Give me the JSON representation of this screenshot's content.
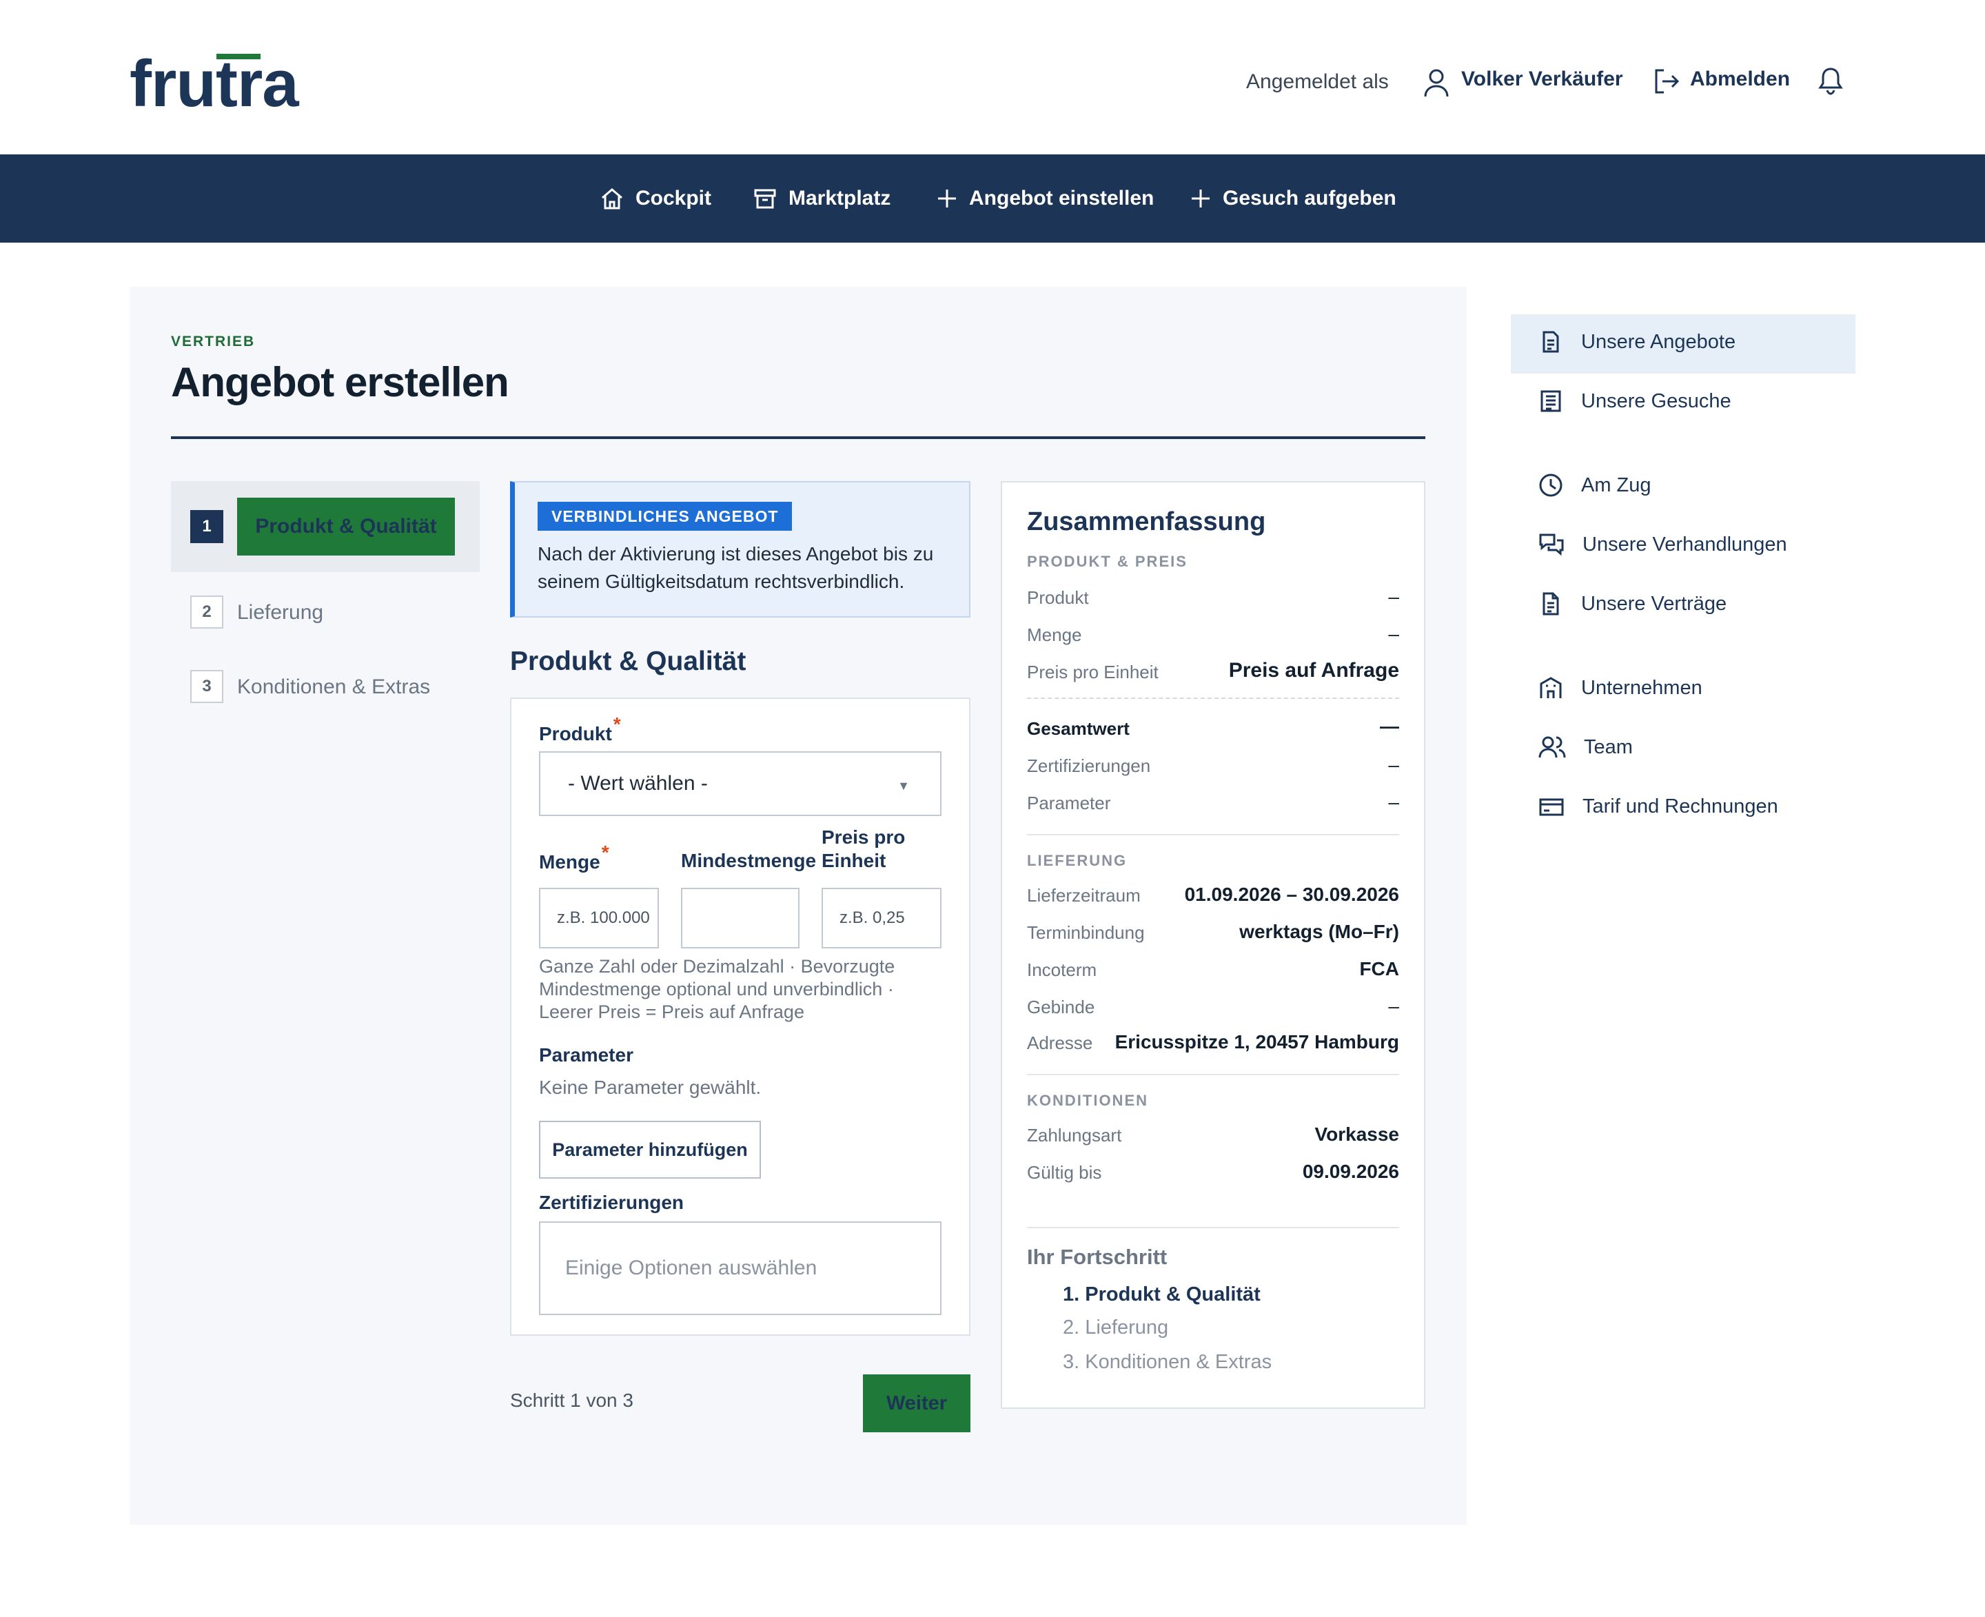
{
  "brand": {
    "logo": "frutra"
  },
  "header": {
    "logged_in_as": "Angemeldet als",
    "user_name": "Volker Verkäufer",
    "logout": "Abmelden"
  },
  "nav": [
    {
      "label": "Cockpit",
      "icon": "home-icon"
    },
    {
      "label": "Marktplatz",
      "icon": "archive-box-icon"
    },
    {
      "label": "Angebot einstellen",
      "icon": "plus-icon"
    },
    {
      "label": "Gesuch aufgeben",
      "icon": "plus-icon"
    }
  ],
  "page": {
    "kicker": "VERTRIEB",
    "title": "Angebot erstellen"
  },
  "stepper": [
    {
      "num": "1",
      "label": "Produkt & Qualität",
      "active": true
    },
    {
      "num": "2",
      "label": "Lieferung",
      "active": false
    },
    {
      "num": "3",
      "label": "Konditionen & Extras",
      "active": false
    }
  ],
  "notice": {
    "badge": "VERBINDLICHES ANGEBOT",
    "text": "Nach der Aktivierung ist dieses Angebot bis zu seinem Gültigkeitsdatum rechtsverbindlich."
  },
  "form": {
    "section_title": "Produkt & Qualität",
    "product_label": "Produkt",
    "product_value": "- Wert wählen -",
    "qty_label": "Menge",
    "qty_placeholder": "z.B. 100.000",
    "min_label": "Mindestmenge",
    "min_placeholder": "",
    "price_label": "Preis pro Einheit",
    "price_placeholder": "z.B. 0,25",
    "help_text": "Ganze Zahl oder Dezimalzahl · Bevorzugte Mindestmenge optional und unverbindlich · Leerer Preis = Preis auf Anfrage",
    "params_label": "Parameter",
    "params_empty": "Keine Parameter gewählt.",
    "params_button": "Parameter hinzufügen",
    "certs_label": "Zertifizierungen",
    "certs_placeholder": "Einige Optionen auswählen",
    "step_info": "Schritt 1 von 3",
    "next_button": "Weiter"
  },
  "summary": {
    "title": "Zusammenfassung",
    "sec_product": "PRODUKT & PREIS",
    "product_k": "Produkt",
    "product_v": "–",
    "qty_k": "Menge",
    "qty_v": "–",
    "price_k": "Preis pro Einheit",
    "price_v": "Preis auf Anfrage",
    "total_k": "Gesamtwert",
    "total_v": "—",
    "certs_k": "Zertifizierungen",
    "certs_v": "–",
    "params_k": "Parameter",
    "params_v": "–",
    "sec_delivery": "LIEFERUNG",
    "period_k": "Lieferzeitraum",
    "period_v": "01.09.2026 – 30.09.2026",
    "binding_k": "Terminbindung",
    "binding_v": "werktags (Mo–Fr)",
    "incoterm_k": "Incoterm",
    "incoterm_v": "FCA",
    "container_k": "Gebinde",
    "container_v": "–",
    "address_k": "Adresse",
    "address_v": "Ericusspitze 1, 20457 Hamburg",
    "sec_conditions": "KONDITIONEN",
    "payment_k": "Zahlungsart",
    "payment_v": "Vorkasse",
    "valid_k": "Gültig bis",
    "valid_v": "09.09.2026",
    "progress_title": "Ihr Fortschritt",
    "progress": [
      "1. Produkt & Qualität",
      "2. Lieferung",
      "3. Konditionen & Extras"
    ]
  },
  "sidebar": [
    {
      "label": "Unsere Angebote",
      "icon": "document-icon",
      "active": true
    },
    {
      "label": "Unsere Gesuche",
      "icon": "list-document-icon"
    },
    {
      "label": "Am Zug",
      "icon": "clock-icon"
    },
    {
      "label": "Unsere Verhandlungen",
      "icon": "chat-bubbles-icon"
    },
    {
      "label": "Unsere Verträge",
      "icon": "contract-icon"
    },
    {
      "label": "Unternehmen",
      "icon": "building-icon"
    },
    {
      "label": "Team",
      "icon": "users-icon"
    },
    {
      "label": "Tarif und Rechnungen",
      "icon": "credit-card-icon"
    }
  ],
  "colors": {
    "navy": "#1c3557",
    "green": "#1f7a3a",
    "blue": "#1e6ed8",
    "required": "#e04a1c"
  }
}
